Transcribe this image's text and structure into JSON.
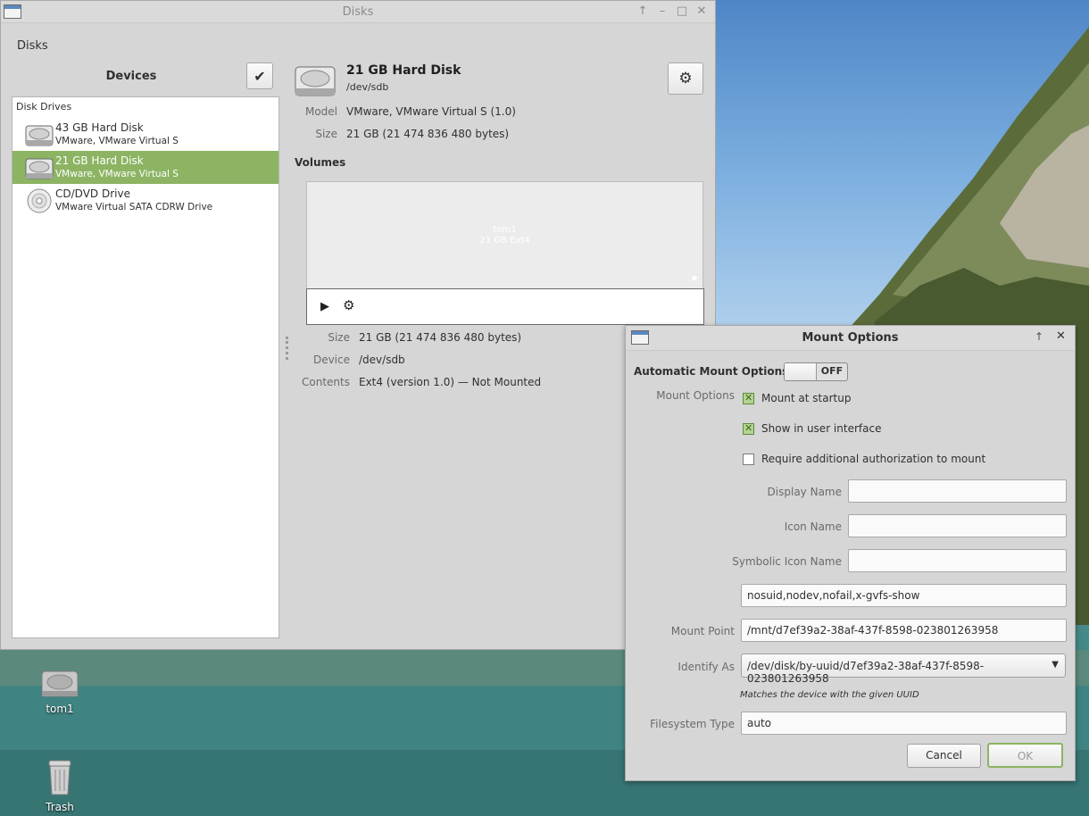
{
  "main_window": {
    "title": "Disks",
    "menu": "Disks",
    "devices_label": "Devices",
    "disk_drives_header": "Disk Drives",
    "devices": [
      {
        "name": "43 GB Hard Disk",
        "sub": "VMware, VMware Virtual S"
      },
      {
        "name": "21 GB Hard Disk",
        "sub": "VMware, VMware Virtual S"
      },
      {
        "name": "CD/DVD Drive",
        "sub": "VMware Virtual SATA CDRW Drive"
      }
    ],
    "selected_disk": {
      "title": "21 GB Hard Disk",
      "device": "/dev/sdb",
      "model_label": "Model",
      "model": "VMware, VMware Virtual S (1.0)",
      "size_label": "Size",
      "size": "21 GB (21 474 836 480 bytes)"
    },
    "volumes_label": "Volumes",
    "volume_block": {
      "name": "tom1",
      "desc": "21 GB Ext4"
    },
    "volume_details": {
      "size_label": "Size",
      "size": "21 GB (21 474 836 480 bytes)",
      "device_label": "Device",
      "device": "/dev/sdb",
      "contents_label": "Contents",
      "contents": "Ext4 (version 1.0) — Not Mounted"
    }
  },
  "dialog": {
    "title": "Mount Options",
    "automatic_label": "Automatic Mount Options",
    "toggle_state": "OFF",
    "mount_options_label": "Mount Options",
    "checkboxes": [
      {
        "label": "Mount at startup",
        "checked": true
      },
      {
        "label": "Show in user interface",
        "checked": true
      },
      {
        "label": "Require additional authorization to mount",
        "checked": false
      }
    ],
    "display_name_label": "Display Name",
    "display_name_value": "",
    "icon_name_label": "Icon Name",
    "icon_name_value": "",
    "symbolic_icon_name_label": "Symbolic Icon Name",
    "symbolic_icon_name_value": "",
    "options_value": "nosuid,nodev,nofail,x-gvfs-show",
    "mount_point_label": "Mount Point",
    "mount_point_value": "/mnt/d7ef39a2-38af-437f-8598-023801263958",
    "identify_as_label": "Identify As",
    "identify_as_value": "/dev/disk/by-uuid/d7ef39a2-38af-437f-8598-023801263958",
    "identify_hint": "Matches the device with the given UUID",
    "filesystem_type_label": "Filesystem Type",
    "filesystem_type_value": "auto",
    "cancel_label": "Cancel",
    "ok_label": "OK"
  },
  "desktop": {
    "icons": [
      {
        "label": "tom1"
      },
      {
        "label": "Trash"
      }
    ]
  },
  "colors": {
    "selection": "#8cb463",
    "checkbox_on": "#b3d394"
  }
}
